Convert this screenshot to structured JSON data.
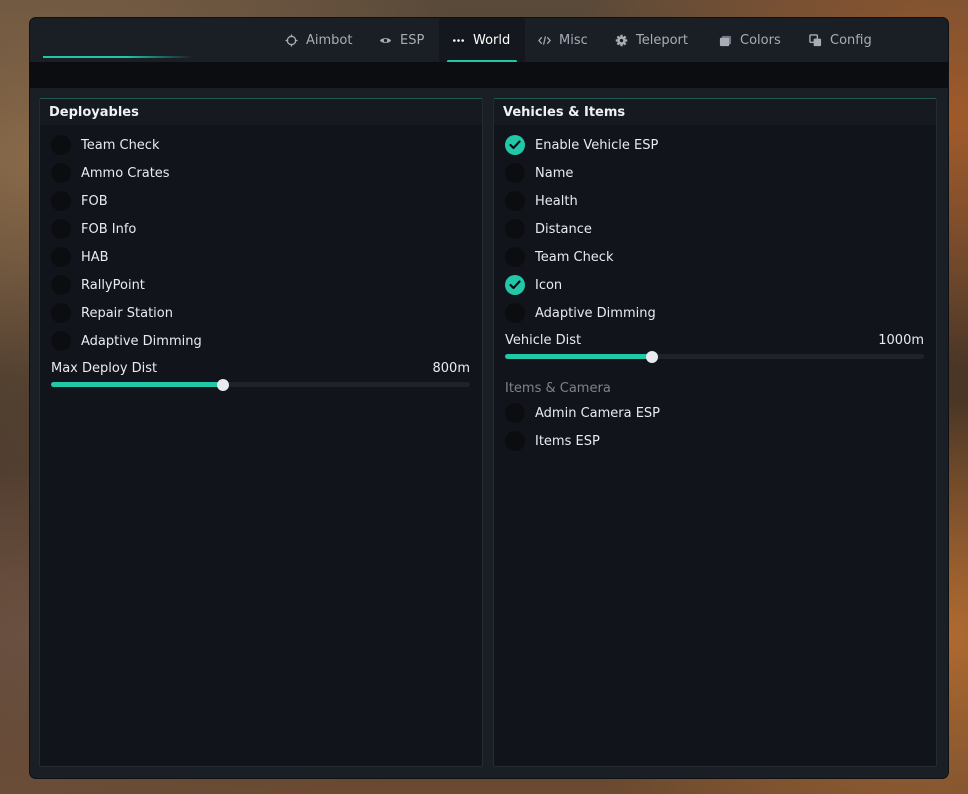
{
  "tabs": [
    {
      "label": "Aimbot",
      "icon": "crosshair-icon"
    },
    {
      "label": "ESP",
      "icon": "eye-icon"
    },
    {
      "label": "World",
      "icon": "dots-icon"
    },
    {
      "label": "Misc",
      "icon": "code-icon"
    },
    {
      "label": "Teleport",
      "icon": "gear-icon"
    },
    {
      "label": "Colors",
      "icon": "palette-icon"
    },
    {
      "label": "Config",
      "icon": "copy-icon"
    }
  ],
  "active_tab": "World",
  "accent": "#22c7a8",
  "left_panel": {
    "title": "Deployables",
    "items": [
      {
        "label": "Team Check",
        "checked": false
      },
      {
        "label": "Ammo Crates",
        "checked": false
      },
      {
        "label": "FOB",
        "checked": false
      },
      {
        "label": "FOB Info",
        "checked": false
      },
      {
        "label": "HAB",
        "checked": false
      },
      {
        "label": "RallyPoint",
        "checked": false
      },
      {
        "label": "Repair Station",
        "checked": false
      },
      {
        "label": "Adaptive Dimming",
        "checked": false
      }
    ],
    "slider": {
      "label": "Max Deploy Dist",
      "value": "800m",
      "fraction": 0.41
    }
  },
  "right_panel": {
    "title": "Vehicles & Items",
    "items": [
      {
        "label": "Enable Vehicle ESP",
        "checked": true
      },
      {
        "label": "Name",
        "checked": false
      },
      {
        "label": "Health",
        "checked": false
      },
      {
        "label": "Distance",
        "checked": false
      },
      {
        "label": "Team Check",
        "checked": false
      },
      {
        "label": "Icon",
        "checked": true
      },
      {
        "label": "Adaptive Dimming",
        "checked": false
      }
    ],
    "slider": {
      "label": "Vehicle Dist",
      "value": "1000m",
      "fraction": 0.35
    },
    "section": "Items & Camera",
    "section_items": [
      {
        "label": "Admin Camera ESP",
        "checked": false
      },
      {
        "label": "Items ESP",
        "checked": false
      }
    ]
  }
}
